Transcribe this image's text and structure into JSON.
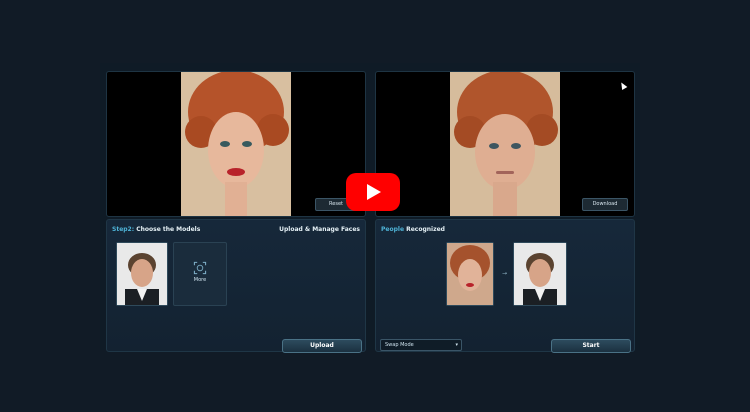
{
  "preview": {
    "reset_label": "Reset",
    "download_label": "Download"
  },
  "models": {
    "step_label": "Step2:",
    "title": "Choose the Models",
    "upload_manage_label": "Upload & Manage Faces",
    "more_label": "More",
    "upload_label": "Upload"
  },
  "recognized": {
    "accent_label": "People",
    "title": "Recognized",
    "select_value": "Swap Mode",
    "start_label": "Start"
  },
  "colors": {
    "accent": "#4fb4d8",
    "youtube_red": "#ff0000",
    "background": "#111b26"
  },
  "icons": {
    "play": "play-icon",
    "face_scan": "face-scan-icon",
    "arrow": "arrow-right-icon"
  }
}
